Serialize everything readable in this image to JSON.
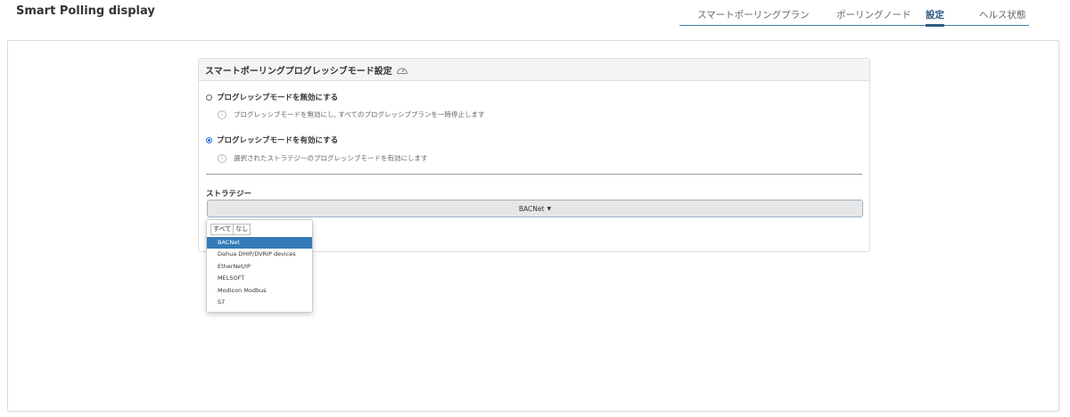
{
  "header": {
    "app_title": "Smart Polling display",
    "tabs": [
      {
        "label": "スマートポーリングプラン",
        "active": false
      },
      {
        "label": "ポーリングノード",
        "active": false
      },
      {
        "label": "設定",
        "active": true
      },
      {
        "label": "ヘルス状態",
        "active": false
      }
    ]
  },
  "panel": {
    "title": "スマートポーリングプログレッシブモード設定",
    "title_icon": "gauge-icon",
    "options": [
      {
        "label": "プログレッシブモードを無効にする",
        "selected": false,
        "info": "プログレッシブモードを無効にし, すべてのプログレッシブプランを一時停止します"
      },
      {
        "label": "プログレッシブモードを有効にする",
        "selected": true,
        "info": "選択されたストラテジーのプログレッシブモードを有効にします"
      }
    ],
    "strategy_label": "ストラテジー",
    "strategy_value": "BACNet"
  },
  "dropdown_menu": {
    "select_all": "すべて",
    "select_none": "なし",
    "items": [
      {
        "label": "BACNet",
        "selected": true
      },
      {
        "label": "Dahua DHIP/DVRIP devices",
        "selected": false
      },
      {
        "label": "EtherNet/IP",
        "selected": false
      },
      {
        "label": "MELSOFT",
        "selected": false
      },
      {
        "label": "Modicon Modbus",
        "selected": false
      },
      {
        "label": "S7",
        "selected": false
      }
    ]
  },
  "colors": {
    "accent": "#2d5b84",
    "selected_bg": "#337ab7"
  }
}
